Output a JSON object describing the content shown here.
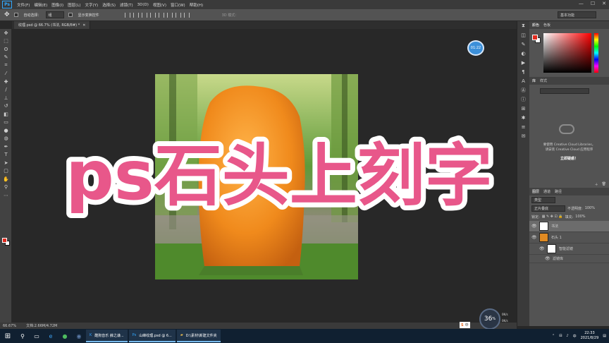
{
  "menubar": {
    "items": [
      "文件(F)",
      "编辑(E)",
      "图像(I)",
      "图层(L)",
      "文字(Y)",
      "选择(S)",
      "滤镜(T)",
      "3D(D)",
      "视图(V)",
      "窗口(W)",
      "帮助(H)"
    ],
    "window_controls": [
      "—",
      "☐",
      "✕"
    ]
  },
  "options": {
    "auto_select_label": "自动选择：",
    "auto_select_value": "组",
    "show_transform_label": "显示变换控件",
    "mode_label": "3D 模式：",
    "workspace": "基本功能"
  },
  "document": {
    "tab_title": "纹理.psd @ 66.7% (书法, RGB/8#) *",
    "overlay_title": "ps石头上刻字",
    "timer": "01:22"
  },
  "status": {
    "zoom": "66.67%",
    "doc_size": "文档:2.66M/4.72M"
  },
  "panels": {
    "color_tabs": [
      "颜色",
      "色板"
    ],
    "library_tabs": [
      "库",
      "样式"
    ],
    "library_message_1": "要使用 Creative Cloud Libraries，",
    "library_message_2": "请安装 Creative Cloud 应用程序",
    "library_link": "立即疑惑！",
    "layers_tabs": [
      "图层",
      "通道",
      "路径"
    ],
    "layer_kind": "类型",
    "blend_mode": "正片叠底",
    "opacity_label": "不透明度:",
    "opacity_value": "100%",
    "lock_label": "锁定:",
    "fill_label": "填充:",
    "fill_value": "100%",
    "layers": [
      {
        "name": "书法"
      },
      {
        "name": "石头 1"
      },
      {
        "name": "智能滤镜"
      },
      {
        "name": "滤镜库"
      }
    ]
  },
  "taskbar": {
    "apps": [
      "酷狗音乐 薛之谦...",
      "山峰纹理.psd @ 6...",
      "D:\\素材\\新建文件夹"
    ],
    "time": "22:33",
    "date": "2021/8/29",
    "speed": "36",
    "speed_unit": "%",
    "speed_up": "0K/s",
    "speed_down": "0K/s",
    "ime": "中"
  },
  "colors": {
    "foreground": "#e02a1e",
    "overlay_text": "#e8578a",
    "accent": "#31a8ff"
  }
}
